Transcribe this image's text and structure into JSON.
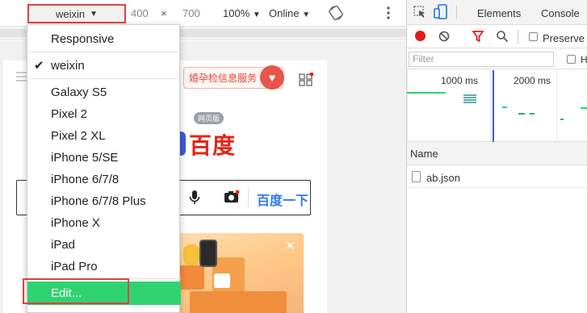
{
  "device_toolbar": {
    "device": "weixin",
    "width": "400",
    "times": "×",
    "height": "700",
    "zoom": "100%",
    "throttle": "Online"
  },
  "device_menu": {
    "items": [
      {
        "label": "Responsive",
        "checked": false
      },
      {
        "label": "weixin",
        "checked": true
      },
      {
        "label": "Galaxy S5",
        "checked": false
      },
      {
        "label": "Pixel 2",
        "checked": false
      },
      {
        "label": "Pixel 2 XL",
        "checked": false
      },
      {
        "label": "iPhone 5/SE",
        "checked": false
      },
      {
        "label": "iPhone 6/7/8",
        "checked": false
      },
      {
        "label": "iPhone 6/7/8 Plus",
        "checked": false
      },
      {
        "label": "iPhone X",
        "checked": false
      },
      {
        "label": "iPad",
        "checked": false
      },
      {
        "label": "iPad Pro",
        "checked": false
      }
    ],
    "edit_label": "Edit..."
  },
  "page": {
    "promo_text": "婚孕检信息服务",
    "web_version": "网页版",
    "logo_text": "百度",
    "search_button": "百度一下"
  },
  "devtools": {
    "tabs": {
      "elements": "Elements",
      "console": "Console"
    },
    "preserve_log": "Preserve",
    "filter_placeholder": "Filter",
    "hide_label": "H",
    "timeline": {
      "tick1": "1000 ms",
      "tick2": "2000 ms"
    },
    "name_header": "Name",
    "requests": [
      {
        "name": "ab.json"
      }
    ]
  },
  "colors": {
    "highlight_outline": "#e04242",
    "edit_highlight": "#2ed36f",
    "record": "#e21b1b",
    "baidu_red": "#e1251b",
    "baidu_blue": "#3377e8"
  }
}
